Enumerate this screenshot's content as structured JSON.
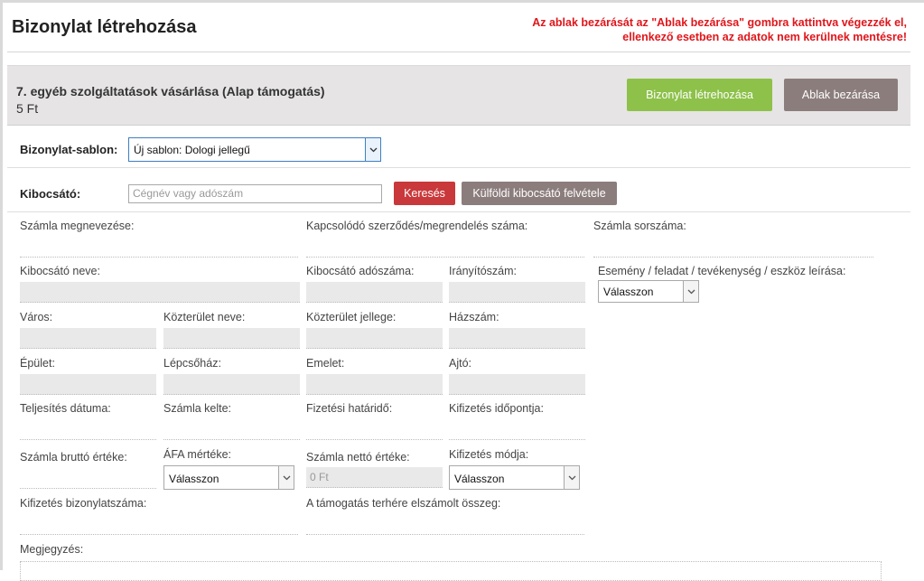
{
  "header": {
    "title": "Bizonylat létrehozása",
    "warning_line1": "Az ablak bezárását az \"Ablak bezárása\" gombra kattintva végezzék el,",
    "warning_line2": "ellenkező esetben az adatok nem kerülnek mentésre!"
  },
  "band": {
    "title": "7. egyéb szolgáltatások vásárlása (Alap támogatás)",
    "amount": "5 Ft",
    "create_button": "Bizonylat létrehozása",
    "close_button": "Ablak bezárása"
  },
  "template": {
    "label": "Bizonylat-sablon:",
    "selected": "Új sablon: Dologi jellegű"
  },
  "issuer": {
    "label": "Kibocsátó:",
    "placeholder": "Cégnév vagy adószám",
    "search_button": "Keresés",
    "foreign_button": "Külföldi kibocsátó felvétele"
  },
  "fields": {
    "invoice_name": "Számla megnevezése:",
    "contract_number": "Kapcsolódó szerződés/megrendelés száma:",
    "invoice_serial": "Számla sorszáma:",
    "issuer_name": "Kibocsátó neve:",
    "issuer_tax": "Kibocsátó adószáma:",
    "zip": "Irányítószám:",
    "event_desc": "Esemény / feladat / tevékenység / eszköz leírása:",
    "event_select": "Válasszon",
    "city": "Város:",
    "street_name": "Közterület neve:",
    "street_type": "Közterület jellege:",
    "house_number": "Házszám:",
    "building": "Épület:",
    "staircase": "Lépcsőház:",
    "floor": "Emelet:",
    "door": "Ajtó:",
    "completion_date": "Teljesítés dátuma:",
    "invoice_date": "Számla kelte:",
    "payment_deadline": "Fizetési határidő:",
    "payment_time": "Kifizetés időpontja:",
    "gross_value": "Számla bruttó értéke:",
    "vat_rate": "ÁFA mértéke:",
    "vat_select": "Válasszon",
    "net_value": "Számla nettó értéke:",
    "net_value_display": "0 Ft",
    "payment_method": "Kifizetés módja:",
    "payment_select": "Válasszon",
    "payment_doc_number": "Kifizetés bizonylatszáma:",
    "support_amount": "A támogatás terhére elszámolt összeg:",
    "note": "Megjegyzés:"
  }
}
